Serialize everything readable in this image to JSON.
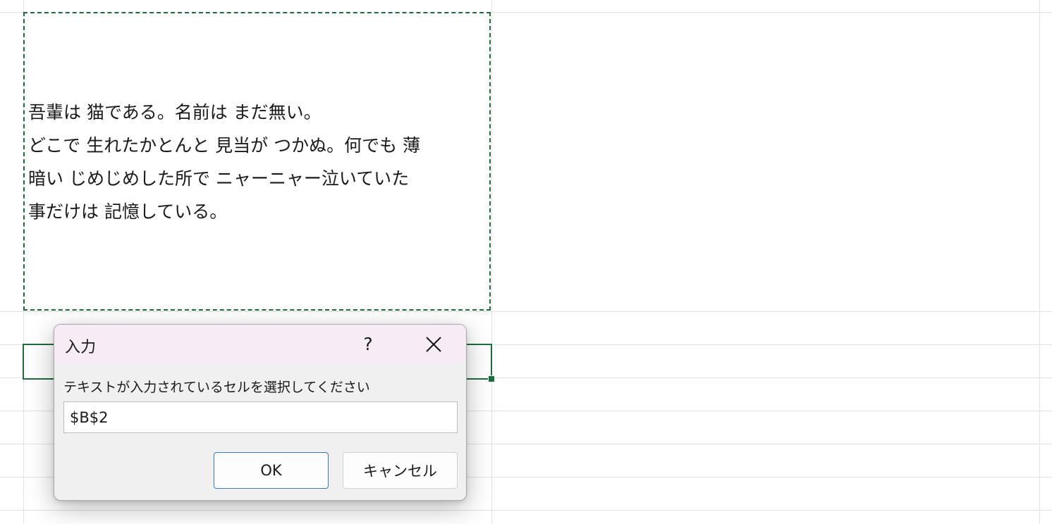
{
  "sheet": {
    "cell_text": "吾輩は 猫である。名前は まだ無い。\nどこで 生れたかとんと 見当が つかぬ。何でも 薄\n暗い じめじめした所で ニャーニャー泣いていた\n事だけは 記憶している。"
  },
  "dialog": {
    "title": "入力",
    "help_label": "?",
    "prompt": "テキストが入力されているセルを選択してください",
    "input_value": "$B$2",
    "ok_label": "OK",
    "cancel_label": "キャンセル"
  },
  "colors": {
    "selection_border": "#1d6b3e",
    "titlebar_background": "#f5ecf5",
    "dialog_background": "#f0f0f0",
    "ok_button_border": "#3a78c2",
    "gridline": "#e1e1e1"
  },
  "icons": {
    "close": "close-icon",
    "help": "question-mark"
  }
}
